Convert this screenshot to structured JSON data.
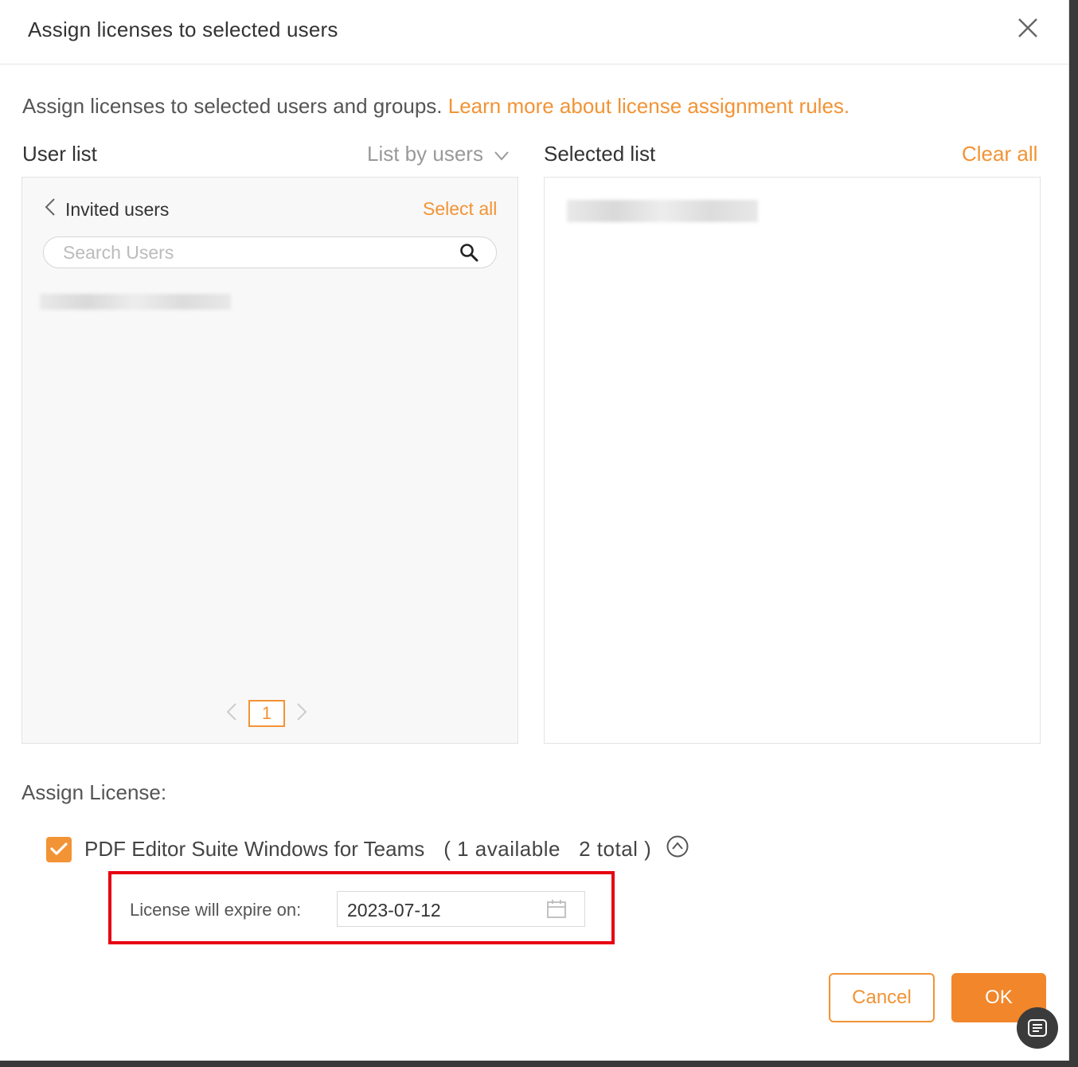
{
  "dialog": {
    "title": "Assign licenses to selected users",
    "intro_text": "Assign licenses to selected users and groups. ",
    "learn_more_link": "Learn more about license assignment rules."
  },
  "user_list": {
    "label": "User list",
    "list_by": "List by users",
    "invited_users": "Invited users",
    "select_all": "Select all",
    "search_placeholder": "Search Users",
    "current_page": "1"
  },
  "selected_list": {
    "label": "Selected list",
    "clear_all": "Clear all"
  },
  "assign_license": {
    "label": "Assign License:",
    "product_name": "PDF Editor Suite Windows for Teams",
    "availability": "( 1 available   2 total )",
    "checked": true,
    "expire_label": "License will expire on:",
    "expire_date": "2023-07-12"
  },
  "buttons": {
    "cancel": "Cancel",
    "ok": "OK"
  },
  "colors": {
    "accent": "#f29335",
    "highlight_box": "#e60012"
  },
  "icons": [
    "close-icon",
    "chevron-down-icon",
    "chevron-left-icon",
    "search-icon",
    "chevron-right-icon",
    "checkmark-icon",
    "collapse-up-icon",
    "calendar-icon",
    "fab-menu-icon"
  ]
}
